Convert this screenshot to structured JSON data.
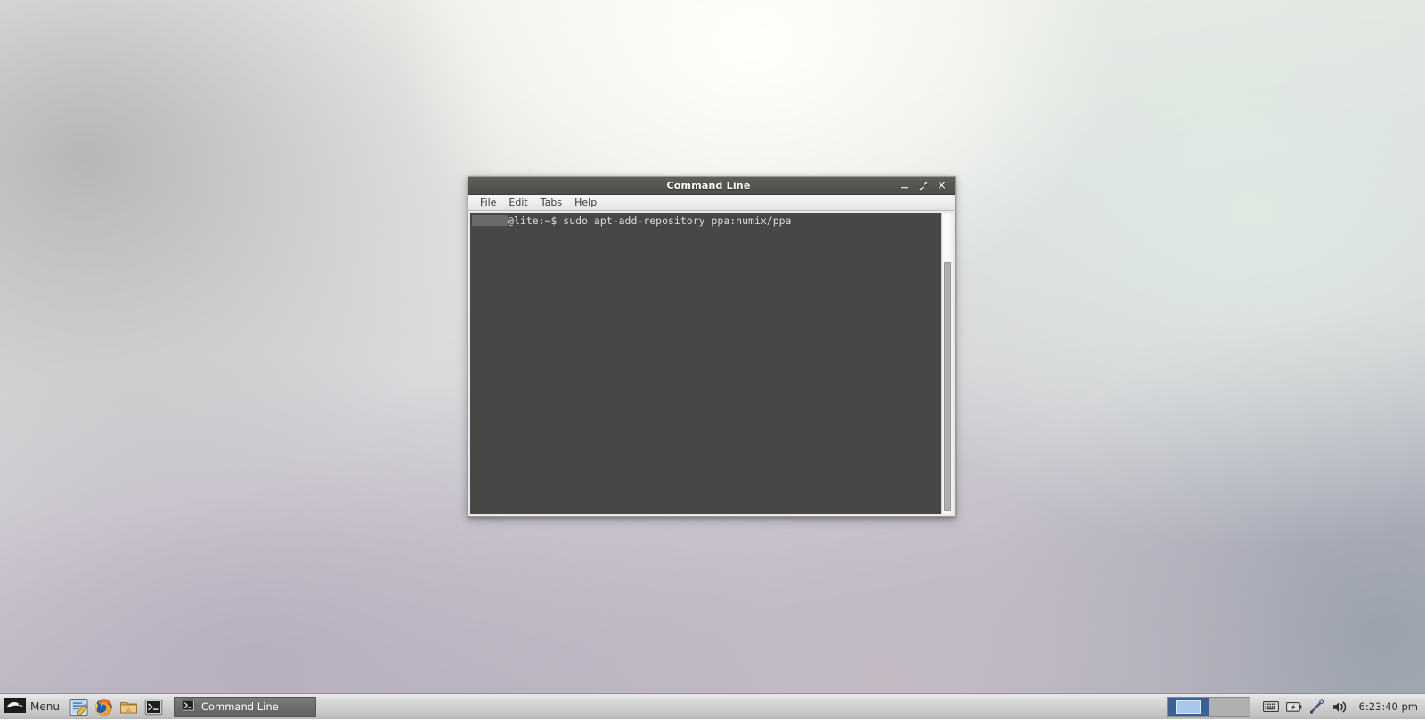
{
  "desktop": {
    "wallpaper_colors": [
      "#f2f3ee",
      "#e4e6e2",
      "#d6d4d8",
      "#bfbcc8",
      "#b2b4c0"
    ]
  },
  "window": {
    "title": "Command Line",
    "controls": {
      "minimize": "minimize-icon",
      "maximize": "maximize-icon",
      "close": "close-icon"
    },
    "menubar": [
      {
        "label": "File"
      },
      {
        "label": "Edit"
      },
      {
        "label": "Tabs"
      },
      {
        "label": "Help"
      }
    ],
    "terminal": {
      "background": "#474745",
      "foreground": "#dcdcdc",
      "lines": [
        {
          "redacted_prefix": true,
          "text": "@lite:~$ sudo apt-add-repository ppa:numix/ppa"
        }
      ]
    },
    "scrollbar": {
      "thumb_color": "#b0b0b0",
      "trough_color": "#f7f7f7"
    }
  },
  "taskbar": {
    "menu": {
      "label": "Menu",
      "icon": "linux-mint-logo-icon"
    },
    "launchers": [
      {
        "name": "text-editor",
        "icon": "text-editor-icon"
      },
      {
        "name": "firefox",
        "icon": "firefox-icon"
      },
      {
        "name": "file-manager",
        "icon": "folder-icon"
      },
      {
        "name": "terminal",
        "icon": "terminal-icon"
      }
    ],
    "tasks": [
      {
        "label": "Command Line",
        "icon": "terminal-icon",
        "active": true
      }
    ],
    "pager": {
      "workspaces": [
        {
          "name": "workspace-1",
          "active": true
        },
        {
          "name": "workspace-2",
          "active": false
        }
      ]
    },
    "tray": [
      {
        "name": "keyboard-layout",
        "icon": "keyboard-icon"
      },
      {
        "name": "battery",
        "icon": "battery-icon"
      },
      {
        "name": "bluetooth",
        "icon": "bluetooth-icon"
      },
      {
        "name": "volume",
        "icon": "speaker-icon"
      }
    ],
    "clock": "6:23:40 pm"
  }
}
